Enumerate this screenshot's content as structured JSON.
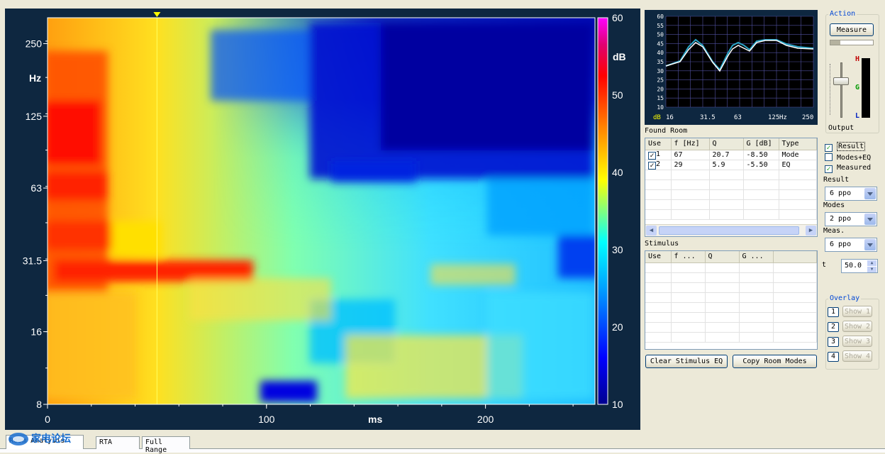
{
  "spectrogram": {
    "y_ticks": [
      "250",
      "125",
      "63",
      "31.5",
      "16",
      "8"
    ],
    "y_unit": "Hz",
    "x_ticks": [
      "0",
      "100",
      "200"
    ],
    "x_unit": "ms",
    "colorbar_ticks": [
      "60",
      "50",
      "40",
      "30",
      "20",
      "10"
    ],
    "colorbar_unit": "dB",
    "x_range_ms": [
      0,
      250
    ],
    "y_range_hz": [
      8,
      320
    ],
    "db_range": [
      10,
      60
    ],
    "cursor_ms": 50
  },
  "mini_chart": {
    "y_ticks": [
      "60",
      "55",
      "50",
      "45",
      "40",
      "35",
      "30",
      "25",
      "20",
      "15",
      "10"
    ],
    "x_ticks": [
      "16",
      "31.5",
      "63",
      "125",
      "250"
    ],
    "y_unit": "dB",
    "x_unit": "Hz"
  },
  "action": {
    "legend": "Action",
    "measure_label": "Measure",
    "meter_h": "H",
    "meter_g": "G",
    "meter_l": "L",
    "output_label": "Output"
  },
  "found_room": {
    "title": "Found Room",
    "columns": [
      "Use",
      "f [Hz]",
      "Q",
      "G [dB]",
      "Type"
    ],
    "rows": [
      {
        "use": "1",
        "checked": true,
        "f": "67",
        "q": "20.7",
        "g": "-8.50",
        "type": "Mode"
      },
      {
        "use": "2",
        "checked": true,
        "f": "29",
        "q": "5.9",
        "g": "-5.50",
        "type": "EQ"
      }
    ]
  },
  "stimulus": {
    "title": "Stimulus",
    "columns": [
      "Use",
      "f ...",
      "Q",
      "G ..."
    ]
  },
  "checks": {
    "result": {
      "label": "Result",
      "checked": true
    },
    "modes_eq": {
      "label": "Modes+EQ",
      "checked": false
    },
    "measured": {
      "label": "Measured",
      "checked": true
    }
  },
  "selects": {
    "result_label": "Result",
    "result_value": "6 ppo",
    "modes_label": "Modes",
    "modes_value": "2 ppo",
    "meas_label": "Meas.",
    "meas_value": "6 ppo",
    "t_label": "t",
    "t_value": "50.0"
  },
  "overlay": {
    "legend": "Overlay",
    "items": [
      {
        "num": "1",
        "label": "Show 1"
      },
      {
        "num": "2",
        "label": "Show 2"
      },
      {
        "num": "3",
        "label": "Show 3"
      },
      {
        "num": "4",
        "label": "Show 4"
      }
    ]
  },
  "buttons": {
    "clear_stimulus": "Clear Stimulus EQ",
    "copy_modes": "Copy Room Modes"
  },
  "tabs": [
    "Room Analysis",
    "RTA",
    "Full Range"
  ],
  "watermark": "家电论坛"
}
